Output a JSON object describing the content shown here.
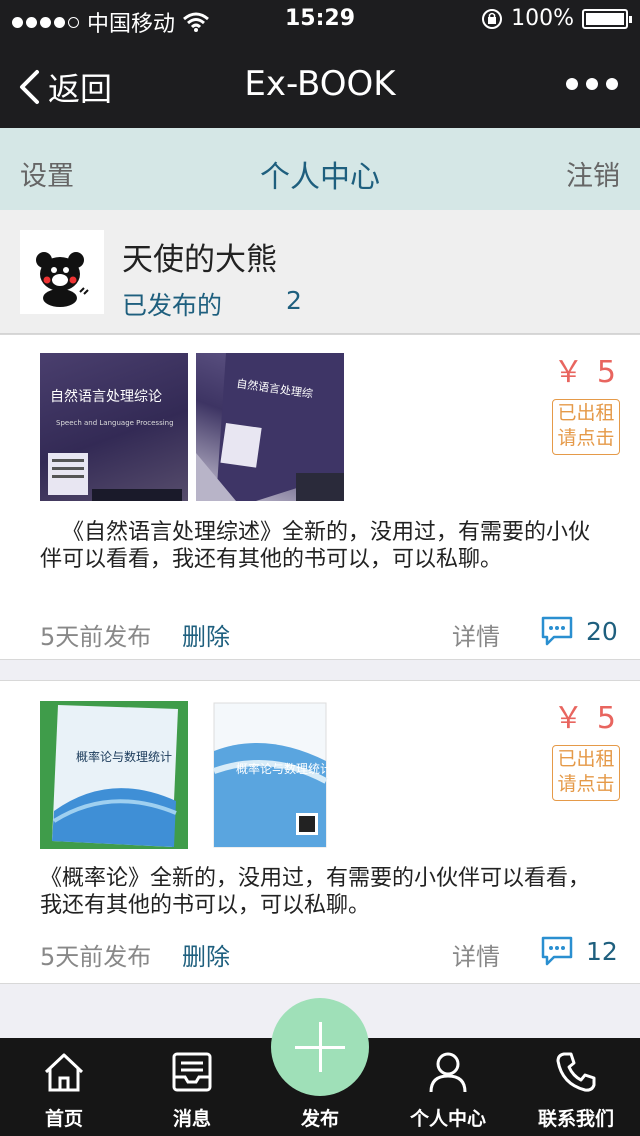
{
  "status_bar": {
    "carrier": "中国移动",
    "time": "15:29",
    "battery": "100%",
    "battery_level": 1.0
  },
  "nav": {
    "back_label": "返回",
    "title": "Ex-BOOK"
  },
  "tabs": {
    "settings": "设置",
    "profile_center": "个人中心",
    "logout": "注销"
  },
  "profile": {
    "name": "天使的大熊",
    "published_label": "已发布的",
    "published_count": "2"
  },
  "posts": [
    {
      "price": "￥ 5",
      "status_line1": "已出租",
      "status_line2": "请点击",
      "description": "《自然语言处理综述》全新的，没用过，有需要的小伙伴可以看看，我还有其他的书可以，可以私聊。",
      "time": "5天前发布",
      "delete_label": "删除",
      "detail_label": "详情",
      "comment_count": "20",
      "book_title": "自然语言处理综论",
      "book_subtitle": "Speech and Language Processing"
    },
    {
      "price": "￥ 5",
      "status_line1": "已出租",
      "status_line2": "请点击",
      "description": "《概率论》全新的，没用过，有需要的小伙伴可以看看，我还有其他的书可以，可以私聊。",
      "time": "5天前发布",
      "delete_label": "删除",
      "detail_label": "详情",
      "comment_count": "12",
      "book_title": "概率论与数理统计"
    }
  ],
  "bottom_tabs": [
    {
      "label": "首页",
      "icon": "home-icon"
    },
    {
      "label": "消息",
      "icon": "inbox-icon"
    },
    {
      "label": "发布",
      "icon": "plus-icon"
    },
    {
      "label": "个人中心",
      "icon": "user-icon"
    },
    {
      "label": "联系我们",
      "icon": "phone-icon"
    }
  ],
  "colors": {
    "accent": "#1e5f7e",
    "price": "#e8655f",
    "rented": "#e59a49",
    "fab": "#9fe0b8"
  }
}
